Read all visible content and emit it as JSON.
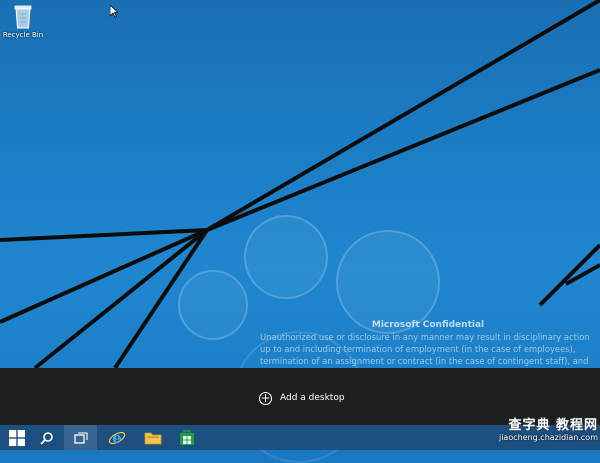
{
  "desktop": {
    "recycle_bin_label": "Recycle Bin",
    "confidential": {
      "title": "Microsoft Confidential",
      "body": "Unauthorized use or disclosure in any manner may result in disciplinary action up to and including termination of employment (in the case of employees), termination of an assignment or contract (in the case of contingent staff), and potential civil and"
    }
  },
  "task_view": {
    "add_desktop_label": "Add a desktop"
  },
  "taskbar": {
    "items": [
      {
        "name": "start-button",
        "icon": "windows-logo-icon"
      },
      {
        "name": "search-button",
        "icon": "search-icon"
      },
      {
        "name": "task-view-button",
        "icon": "task-view-icon"
      },
      {
        "name": "internet-explorer-button",
        "icon": "internet-explorer-icon"
      },
      {
        "name": "file-explorer-button",
        "icon": "folder-icon"
      },
      {
        "name": "store-button",
        "icon": "store-icon"
      }
    ]
  },
  "watermark": {
    "logo_text": "查字典 教程网",
    "url": "jiaocheng.chazidian.com"
  },
  "colors": {
    "wallpaper": "#1a78c2",
    "taskbar": "#1d4f80",
    "strip": "#1c1c1c"
  }
}
